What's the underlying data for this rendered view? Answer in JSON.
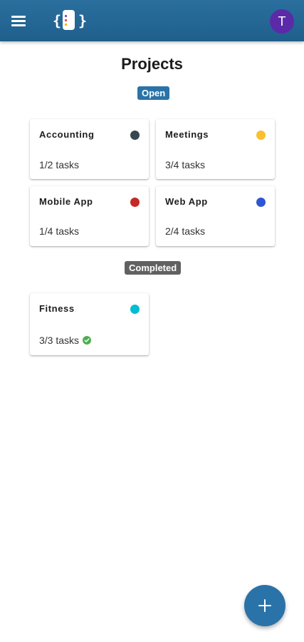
{
  "appbar": {
    "menu_icon": "hamburger-menu-icon",
    "logo_icon": "app-logo-icon",
    "avatar_initial": "T",
    "avatar_color": "#5b2aa8",
    "bar_color": "#2a6f9e"
  },
  "page": {
    "title": "Projects"
  },
  "sections": {
    "open_label": "Open",
    "completed_label": "Completed"
  },
  "projects": [
    {
      "name": "Accounting",
      "tasks": "1/2 tasks",
      "color": "#37474f"
    },
    {
      "name": "Meetings",
      "tasks": "3/4 tasks",
      "color": "#fbc02d"
    },
    {
      "name": "Mobile App",
      "tasks": "1/4 tasks",
      "color": "#c62828"
    },
    {
      "name": "Web App",
      "tasks": "2/4 tasks",
      "color": "#2f55d4"
    },
    {
      "name": "Fitness",
      "tasks": "3/3 tasks",
      "color": "#00bcd4",
      "completed": true,
      "status_icon": "check-circle-icon"
    }
  ],
  "fab": {
    "icon": "plus-icon",
    "label": "+"
  }
}
